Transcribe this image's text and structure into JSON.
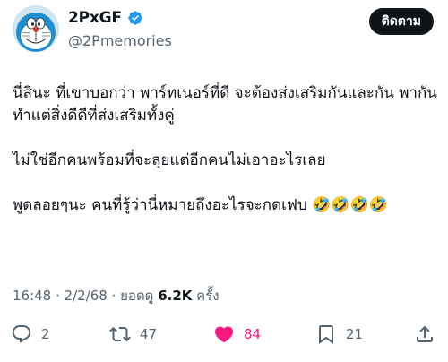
{
  "author": {
    "name": "2PxGF",
    "handle": "@2Pmemories"
  },
  "follow_button": {
    "label": "ติดตาม"
  },
  "tweet": {
    "paragraphs": [
      "นี่สินะ ที่เขาบอกว่า พาร์ทเนอร์ที่ดี จะต้องส่งเสริมกันและกัน พากันทำแต่สิ่งดีดีที่ส่งเสริมทั้งคู่",
      "ไม่ใช่อีกคนพร้อมที่จะลุยแต่อีกคนไม่เอาอะไรเลย",
      "พูดลอยๆนะ คนที่รู้ว่านี่หมายถึงอะไรจะกดเฟบ 🤣🤣🤣🤣"
    ]
  },
  "meta": {
    "time": "16:48",
    "separator1": " · ",
    "date": "2/2/68",
    "separator2": " · ",
    "views_prefix": "ยอดดู ",
    "views_count": "6.2K",
    "views_suffix": " ครั้ง"
  },
  "actions": {
    "reply_count": "2",
    "retweet_count": "47",
    "like_count": "84",
    "bookmark_count": "21"
  },
  "colors": {
    "like": "#f91880",
    "verified": "#1d9bf0",
    "secondary_text": "#536471"
  }
}
